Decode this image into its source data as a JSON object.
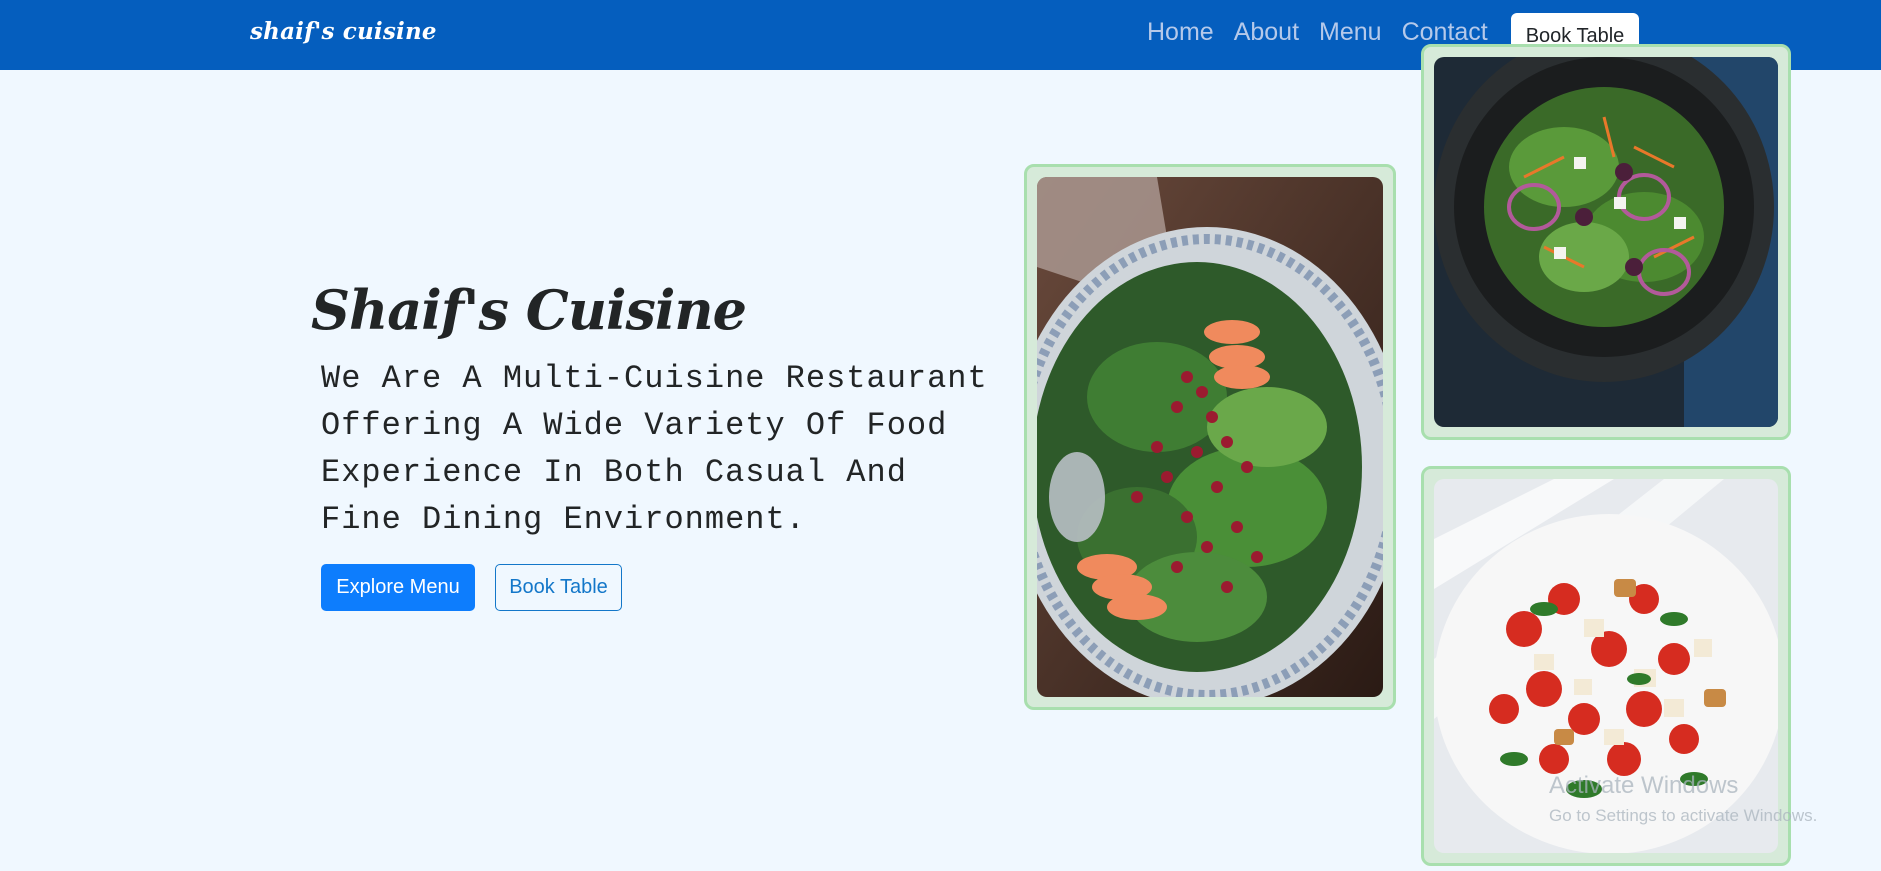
{
  "navbar": {
    "brand": "shaif's cuisine",
    "links": [
      "Home",
      "About",
      "Menu",
      "Contact"
    ],
    "cta_label": "Book Table",
    "background": "#055ebe"
  },
  "hero": {
    "title": "Shaif's Cuisine",
    "text": "We Are A Multi-Cuisine Restaurant Offering A Wide Variety Of Food Experience In Both Casual And Fine Dining Environment.",
    "primary_button": "Explore Menu",
    "outline_button": "Book Table"
  },
  "gallery": {
    "images": [
      "salad-plate-image",
      "dark-bowl-salad-image",
      "caprese-salad-image"
    ],
    "frame_color": "#a8dfae"
  },
  "watermark": {
    "title": "Activate Windows",
    "subtitle": "Go to Settings to activate Windows."
  },
  "colors": {
    "page_background": "#f0f8ff",
    "accent": "#0d7dfd",
    "text": "#222526"
  }
}
